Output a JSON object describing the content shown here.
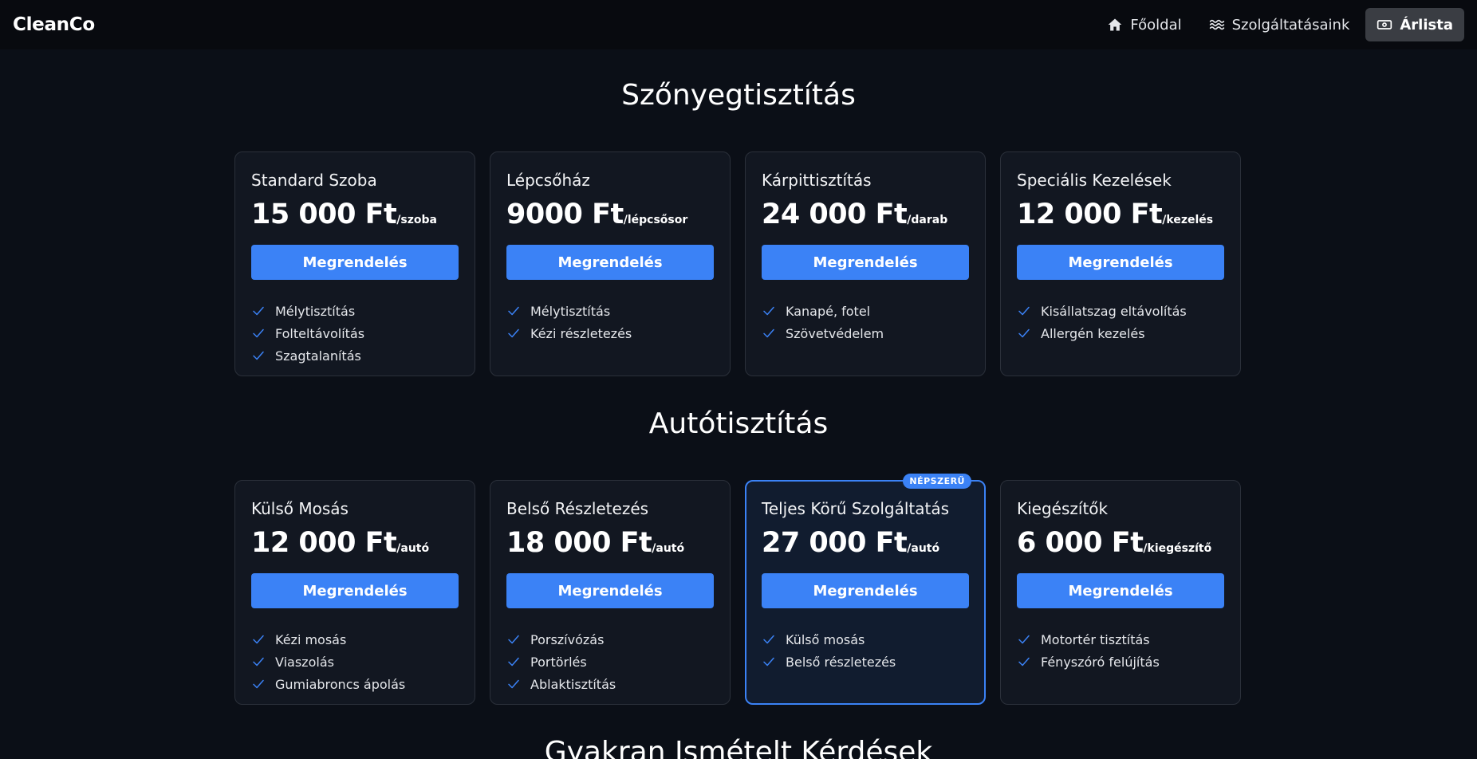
{
  "nav": {
    "brand": "CleanCo",
    "links": [
      {
        "label": "Főoldal",
        "icon": "home-icon",
        "active": false
      },
      {
        "label": "Szolgáltatásaink",
        "icon": "waves-icon",
        "active": false
      },
      {
        "label": "Árlista",
        "icon": "banknote-icon",
        "active": true
      }
    ]
  },
  "sections": {
    "carpet_title": "Szőnyegtisztítás",
    "car_title": "Autótisztítás",
    "faq_title": "Gyakran Ismételt Kérdések"
  },
  "colors": {
    "accent": "#3b82f6",
    "background": "#0b0f17",
    "card": "#121721"
  },
  "carpet": [
    {
      "name": "Standard Szoba",
      "price": "15 000 Ft",
      "unit": "/szoba",
      "button": "Megrendelés",
      "features": [
        "Mélytisztítás",
        "Folteltávolítás",
        "Szagtalanítás"
      ]
    },
    {
      "name": "Lépcsőház",
      "price": "9000 Ft",
      "unit": "/lépcsősor",
      "button": "Megrendelés",
      "features": [
        "Mélytisztítás",
        "Kézi részletezés"
      ]
    },
    {
      "name": "Kárpittisztítás",
      "price": "24 000 Ft",
      "unit": "/darab",
      "button": "Megrendelés",
      "features": [
        "Kanapé, fotel",
        "Szövetvédelem"
      ]
    },
    {
      "name": "Speciális Kezelések",
      "price": "12 000 Ft",
      "unit": "/kezelés",
      "button": "Megrendelés",
      "features": [
        "Kisállatszag eltávolítás",
        "Allergén kezelés"
      ]
    }
  ],
  "car": [
    {
      "name": "Külső Mosás",
      "price": "12 000 Ft",
      "unit": "/autó",
      "button": "Megrendelés",
      "features": [
        "Kézi mosás",
        "Viaszolás",
        "Gumiabroncs ápolás"
      ]
    },
    {
      "name": "Belső Részletezés",
      "price": "18 000 Ft",
      "unit": "/autó",
      "button": "Megrendelés",
      "features": [
        "Porszívózás",
        "Portörlés",
        "Ablaktisztítás"
      ]
    },
    {
      "name": "Teljes Körű Szolgáltatás",
      "price": "27 000 Ft",
      "unit": "/autó",
      "button": "Megrendelés",
      "badge": "NÉPSZERŰ",
      "features": [
        "Külső mosás",
        "Belső részletezés"
      ]
    },
    {
      "name": "Kiegészítők",
      "price": "6 000 Ft",
      "unit": "/kiegészítő",
      "button": "Megrendelés",
      "features": [
        "Motortér tisztítás",
        "Fényszóró felújítás"
      ]
    }
  ]
}
